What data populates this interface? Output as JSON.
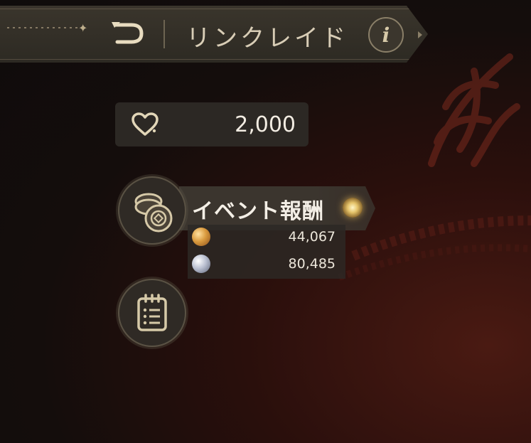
{
  "header": {
    "title": "リンクレイド",
    "info_label": "i"
  },
  "stamina": {
    "value": "2,000"
  },
  "event": {
    "label": "イベント報酬"
  },
  "currencies": [
    {
      "name": "gold-medal",
      "value": "44,067",
      "color": "#d99a3e"
    },
    {
      "name": "silver-medal",
      "value": "80,485",
      "color": "#b9bfd0"
    }
  ],
  "icons": {
    "back": "return-arrow-icon",
    "info": "info-icon",
    "stamina": "heart-icon",
    "event": "coins-icon",
    "list": "clipboard-list-icon"
  },
  "colors": {
    "accent_gold": "#d6c9a8",
    "banner_bg": "#3b352e",
    "background": "#140d0c"
  }
}
